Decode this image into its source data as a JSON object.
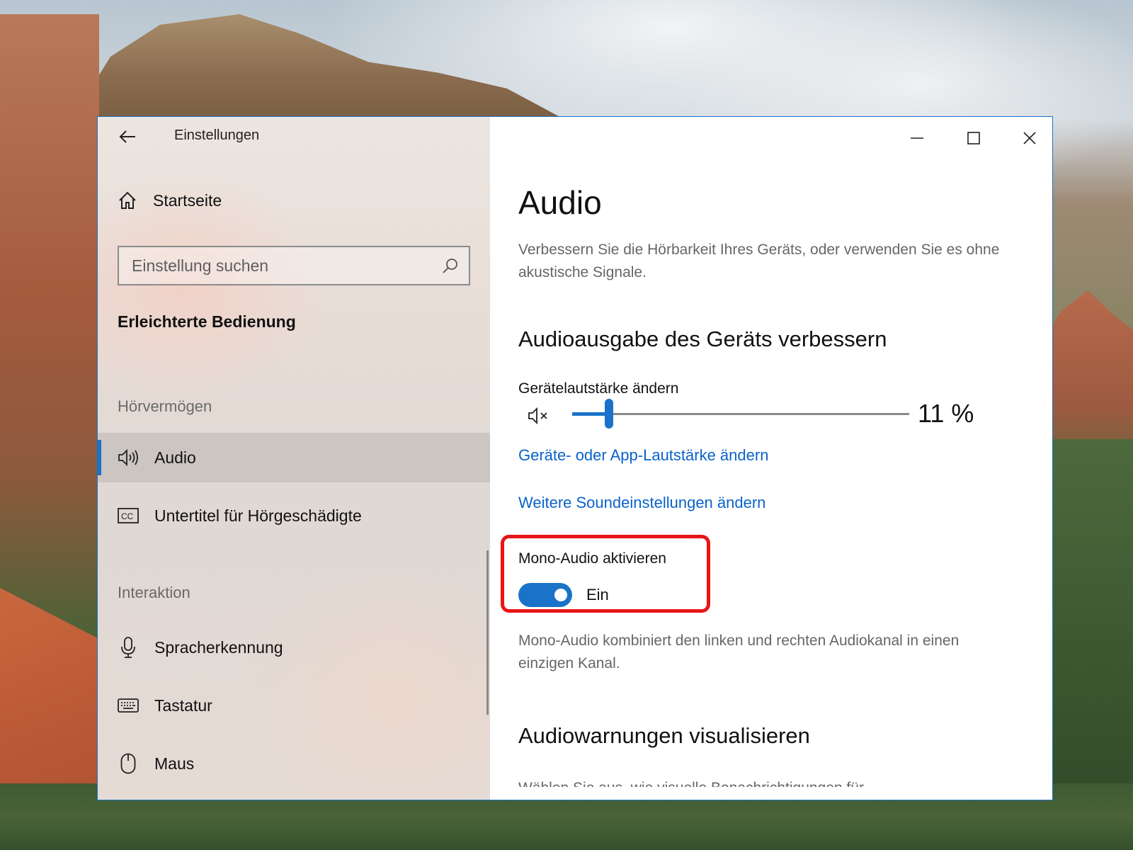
{
  "window": {
    "title": "Einstellungen",
    "accent_color": "#1a73c8"
  },
  "sidebar": {
    "home_label": "Startseite",
    "search_placeholder": "Einstellung suchen",
    "category": "Erleichterte Bedienung",
    "groups": [
      {
        "label": "Hörvermögen",
        "items": [
          {
            "label": "Audio",
            "icon": "speaker-icon",
            "active": true
          },
          {
            "label": "Untertitel für Hörgeschädigte",
            "icon": "closed-captions-icon",
            "active": false
          }
        ]
      },
      {
        "label": "Interaktion",
        "items": [
          {
            "label": "Spracherkennung",
            "icon": "microphone-icon",
            "active": false
          },
          {
            "label": "Tastatur",
            "icon": "keyboard-icon",
            "active": false
          },
          {
            "label": "Maus",
            "icon": "mouse-icon",
            "active": false
          }
        ]
      }
    ]
  },
  "main": {
    "title": "Audio",
    "description": "Verbessern Sie die Hörbarkeit Ihres Geräts, oder verwenden Sie es ohne akustische Signale.",
    "section_output": "Audioausgabe des Geräts verbessern",
    "volume": {
      "label": "Gerätelautstärke ändern",
      "value": 11,
      "value_text": "11 %",
      "icon": "speaker-muted-icon"
    },
    "link_app_volume": "Geräte- oder App-Lautstärke ändern",
    "link_more_sound": "Weitere Soundeinstellungen ändern",
    "mono": {
      "label": "Mono-Audio aktivieren",
      "state": "Ein",
      "enabled": true,
      "description": "Mono-Audio kombiniert den linken und rechten Audiokanal in einen einzigen Kanal.",
      "highlight_color": "#e81515"
    },
    "section_warnings": "Audiowarnungen visualisieren",
    "warnings_desc_partial": "Wählen Sie aus, wie visuelle Benachrichtigungen für"
  }
}
